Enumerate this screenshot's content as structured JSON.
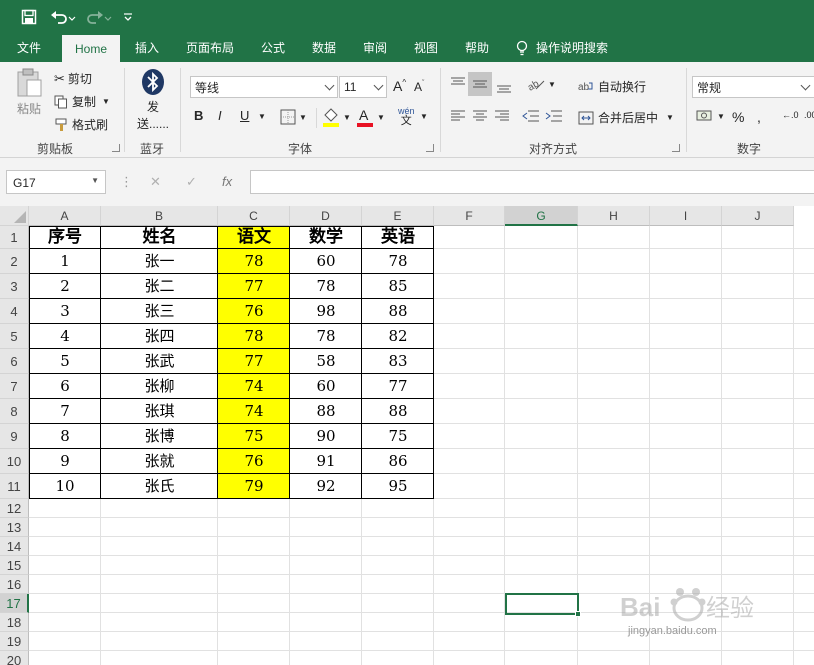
{
  "quick_access": {
    "save": "save-icon",
    "undo": "undo-icon",
    "redo": "redo-icon",
    "customize": "chevron-down-icon"
  },
  "tabs": [
    "文件",
    "Home",
    "插入",
    "页面布局",
    "公式",
    "数据",
    "审阅",
    "视图",
    "帮助"
  ],
  "search_label": "操作说明搜索",
  "clipboard": {
    "paste": "粘贴",
    "cut": "剪切",
    "copy": "复制",
    "format_painter": "格式刷",
    "label": "剪贴板"
  },
  "bluetooth": {
    "send_line1": "发",
    "send_line2": "送......",
    "label": "蓝牙"
  },
  "font": {
    "name": "等线",
    "size": "11",
    "grow": "A",
    "shrink": "A",
    "bold": "B",
    "italic": "I",
    "underline": "U",
    "wen": "wén",
    "wen_char": "文",
    "label": "字体"
  },
  "alignment": {
    "wrap": "自动换行",
    "merge": "合并后居中",
    "label": "对齐方式"
  },
  "number": {
    "format": "常规",
    "percent": "%",
    "label": "数字",
    "inc": "←.0",
    "dec": ".00"
  },
  "formula_bar": {
    "namebox": "G17",
    "cancel": "✕",
    "enter": "✓",
    "fx": "fx",
    "value": ""
  },
  "columns": [
    "A",
    "B",
    "C",
    "D",
    "E",
    "F",
    "G",
    "H",
    "I",
    "J"
  ],
  "rows": [
    "1",
    "2",
    "3",
    "4",
    "5",
    "6",
    "7",
    "8",
    "9",
    "10",
    "11",
    "12",
    "13",
    "14",
    "15",
    "16",
    "17",
    "18",
    "19",
    "20"
  ],
  "selected": {
    "column": "G",
    "row": "17"
  },
  "table": {
    "headers": [
      "序号",
      "姓名",
      "语文",
      "数学",
      "英语"
    ],
    "rows": [
      [
        "1",
        "张一",
        "78",
        "60",
        "78"
      ],
      [
        "2",
        "张二",
        "77",
        "78",
        "85"
      ],
      [
        "3",
        "张三",
        "76",
        "98",
        "88"
      ],
      [
        "4",
        "张四",
        "78",
        "78",
        "82"
      ],
      [
        "5",
        "张武",
        "77",
        "58",
        "83"
      ],
      [
        "6",
        "张柳",
        "74",
        "60",
        "77"
      ],
      [
        "7",
        "张琪",
        "74",
        "88",
        "88"
      ],
      [
        "8",
        "张博",
        "75",
        "90",
        "75"
      ],
      [
        "9",
        "张就",
        "76",
        "91",
        "86"
      ],
      [
        "10",
        "张氏",
        "79",
        "92",
        "95"
      ]
    ],
    "highlight_color": "#ffff00",
    "highlight_column": "语文"
  },
  "watermark": {
    "brand": "Bai经验",
    "url": "jingyan.baidu.com"
  },
  "colors": {
    "accent": "#217346",
    "ribbon": "#f3f3f3"
  }
}
